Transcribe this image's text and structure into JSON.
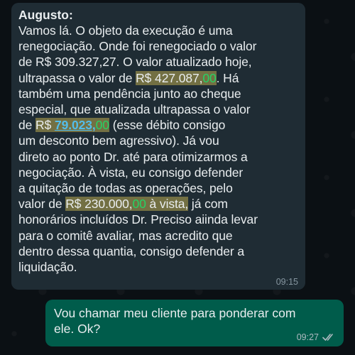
{
  "chat": {
    "incoming": {
      "sender": "Augusto:",
      "text_1": "Vamos lá. O objeto da execução é uma\nrenegociação. Onde foi renegociado o valor\nde R$ 309.327,27. O valor atualizado hoje,\nultrapassa o valor de ",
      "amount_1": "R$ 427.087,",
      "amount_1_cents": "00",
      "text_2": ". Há\ntambém uma  pendência junto ao cheque\nespecial, que atualizada ultrapassa o valor\nde ",
      "amount_2_prefix": "R$ ",
      "amount_2_link": "79.023,",
      "amount_2_cents": "00",
      "text_3": " (esse débito consigo\num desconto bem agressivo). Já vou\ndireto ao ponto Dr. até para otimizarmos a\nnegociação. À vista, eu consigo defender\na quitação de todas as operações, pelo\nvalor de ",
      "amount_3": "R$ 230.000,",
      "amount_3_cents": "00",
      "amount_3_suffix": " à vista,",
      "text_4": " já com\nhonorários incluídos Dr. Preciso aiinda levar\npara o comitê avaliar, mas acredito que\ndentro dessa quantia, consigo defender a\nliquidação.",
      "time": "09:15"
    },
    "outgoing": {
      "text": "Vou chamar meu cliente para ponderar com\nele. Ok?",
      "time": "09:27",
      "status_icon": "double-check-icon"
    }
  },
  "colors": {
    "incoming_bubble": "#1f2c34",
    "outgoing_bubble": "#005c4b",
    "highlight": "#b8aa50",
    "link": "#53bdeb",
    "cents": "#25d366"
  }
}
